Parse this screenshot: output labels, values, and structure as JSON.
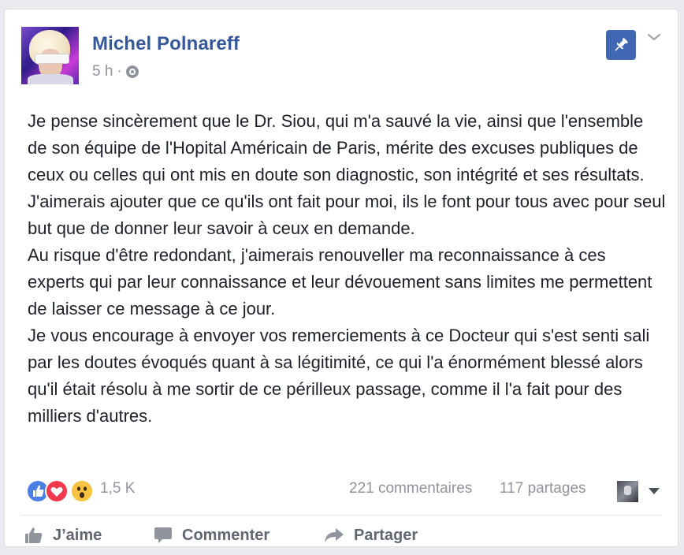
{
  "post": {
    "author": "Michel Polnareff",
    "time": "5 h",
    "separator": "·",
    "privacy_icon": "globe-icon",
    "pin_icon": "pin-icon",
    "menu_icon": "chevron-down-icon",
    "paragraphs": [
      "Je pense sincèrement que le Dr. Siou, qui m'a sauvé la vie, ainsi que l'ensemble de son équipe de l'Hopital Américain de Paris, mérite des excuses publiques de ceux ou celles qui ont mis en doute son diagnostic, son intégrité et ses résultats.",
      "J'aimerais ajouter que ce qu'ils ont fait pour moi, ils le font pour tous avec pour seul but que de donner leur savoir à ceux en demande.",
      "Au risque d'être redondant, j'aimerais renouveller ma reconnaissance à ces experts qui par leur connaissance et leur dévouement sans limites me permettent de laisser ce message à ce jour.",
      "Je vous encourage à envoyer vos remerciements à ce Docteur qui s'est senti sali par les doutes évoqués quant à sa légitimité, ce qui l'a énormément blessé alors qu'il était résolu à me sortir de ce périlleux passage, comme il l'a fait pour des milliers d'autres."
    ]
  },
  "stats": {
    "reactions_icons": [
      "like-reaction-icon",
      "love-reaction-icon",
      "wow-reaction-icon"
    ],
    "reaction_count": "1,5 K",
    "comments": "221 commentaires",
    "shares": "117 partages"
  },
  "actions": {
    "like": "J’aime",
    "comment": "Commenter",
    "share": "Partager"
  },
  "colors": {
    "link": "#365899",
    "secondary_text": "#90949c",
    "accent": "#4267b2"
  }
}
